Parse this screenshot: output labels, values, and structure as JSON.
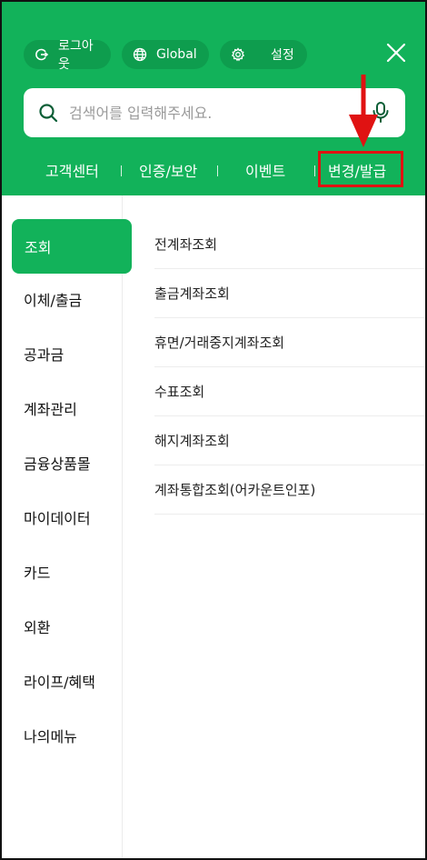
{
  "header": {
    "pills": {
      "logout": "로그아웃",
      "global": "Global",
      "settings": "설정"
    },
    "close_icon": "close-icon"
  },
  "search": {
    "placeholder": "검색어를 입력해주세요.",
    "value": ""
  },
  "quick_links": [
    "고객센터",
    "인증/보안",
    "이벤트",
    "변경/발급"
  ],
  "sidebar": {
    "items": [
      "조회",
      "이체/출금",
      "공과금",
      "계좌관리",
      "금융상품몰",
      "마이데이터",
      "카드",
      "외환",
      "라이프/혜택",
      "나의메뉴"
    ],
    "active": "조회"
  },
  "content": {
    "items": [
      "전계좌조회",
      "출금계좌조회",
      "휴면/거래중지계좌조회",
      "수표조회",
      "해지계좌조회",
      "계좌통합조회(어카운트인포)"
    ]
  },
  "colors": {
    "brand": "#12b25a",
    "pill_bg": "#0e9d4e",
    "annotation": "#e01212"
  },
  "icons": [
    "logout-icon",
    "globe-icon",
    "gear-icon",
    "close-icon",
    "search-icon",
    "mic-icon"
  ]
}
